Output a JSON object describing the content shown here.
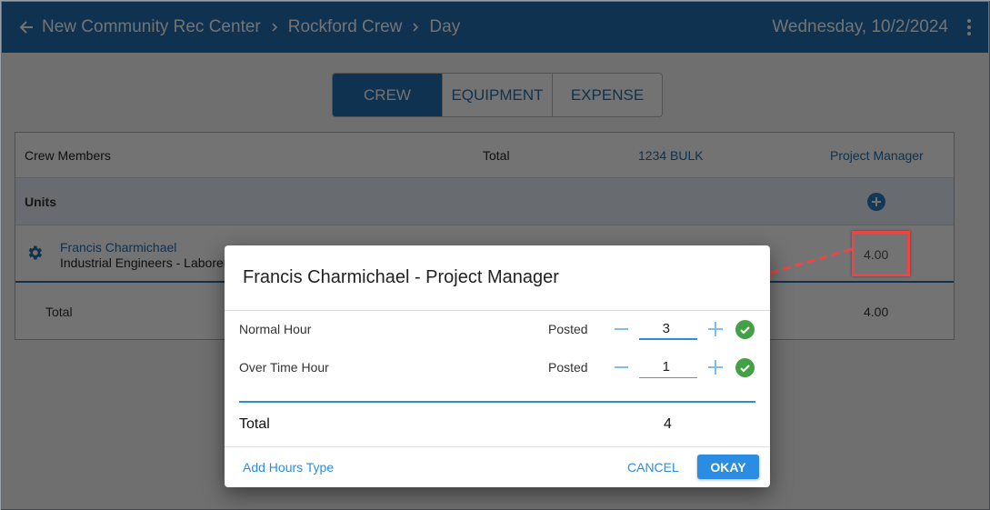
{
  "header": {
    "back_icon": "arrow-left-icon",
    "breadcrumbs": [
      "New Community Rec Center",
      "Rockford Crew",
      "Day"
    ],
    "separator_icon": "chevron-right-icon",
    "date": "Wednesday, 10/2/2024",
    "menu_icon": "more-vert-icon"
  },
  "tabs": [
    {
      "label": "CREW",
      "active": true
    },
    {
      "label": "EQUIPMENT",
      "active": false
    },
    {
      "label": "EXPENSE",
      "active": false
    }
  ],
  "table": {
    "columns": [
      "Crew Members",
      "Total",
      "1234 BULK",
      "Project Manager"
    ],
    "units_label": "Units",
    "add_icon": "plus-circle-icon",
    "member": {
      "icon": "gear-icon",
      "name": "Francis Charmichael",
      "role": "Industrial Engineers - Laborer",
      "project_manager_value": "4.00"
    },
    "total_label": "Total",
    "total_project_manager": "4.00"
  },
  "dialog": {
    "title": "Francis Charmichael - Project Manager",
    "rows": [
      {
        "label": "Normal Hour",
        "status": "Posted",
        "value": "3"
      },
      {
        "label": "Over Time Hour",
        "status": "Posted",
        "value": "1"
      }
    ],
    "total_label": "Total",
    "total_value": "4",
    "add_hours_type": "Add Hours Type",
    "cancel": "CANCEL",
    "okay": "OKAY"
  },
  "colors": {
    "brand": "#1f6fb2",
    "accent": "#2a8de3",
    "success": "#43a047",
    "annotation": "#ef4444"
  }
}
